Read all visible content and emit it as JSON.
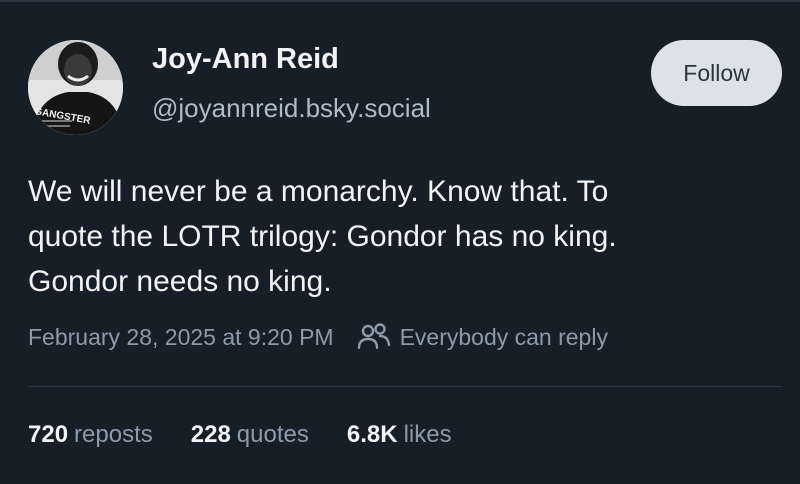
{
  "author": {
    "display_name": "Joy-Ann Reid",
    "handle": "@joyannreid.bsky.social",
    "avatar_icon": "profile-photo",
    "avatar_shirt_text": "GANGSTER"
  },
  "follow_button": {
    "label": "Follow"
  },
  "post": {
    "lines": [
      "We will never be a monarchy. Know that. To",
      "quote the LOTR trilogy: Gondor has no king.",
      "Gondor needs no king."
    ]
  },
  "meta": {
    "timestamp": "February 28, 2025 at 9:20 PM",
    "reply_icon": "people-icon",
    "reply_setting": "Everybody can reply"
  },
  "stats": {
    "reposts": {
      "count": "720",
      "label": "reposts"
    },
    "quotes": {
      "count": "228",
      "label": "quotes"
    },
    "likes": {
      "count": "6.8K",
      "label": "likes"
    }
  },
  "colors": {
    "background": "#161e27",
    "text": "#f1f3f5",
    "muted": "#8d9aab",
    "follow_bg": "#dce2ea"
  }
}
